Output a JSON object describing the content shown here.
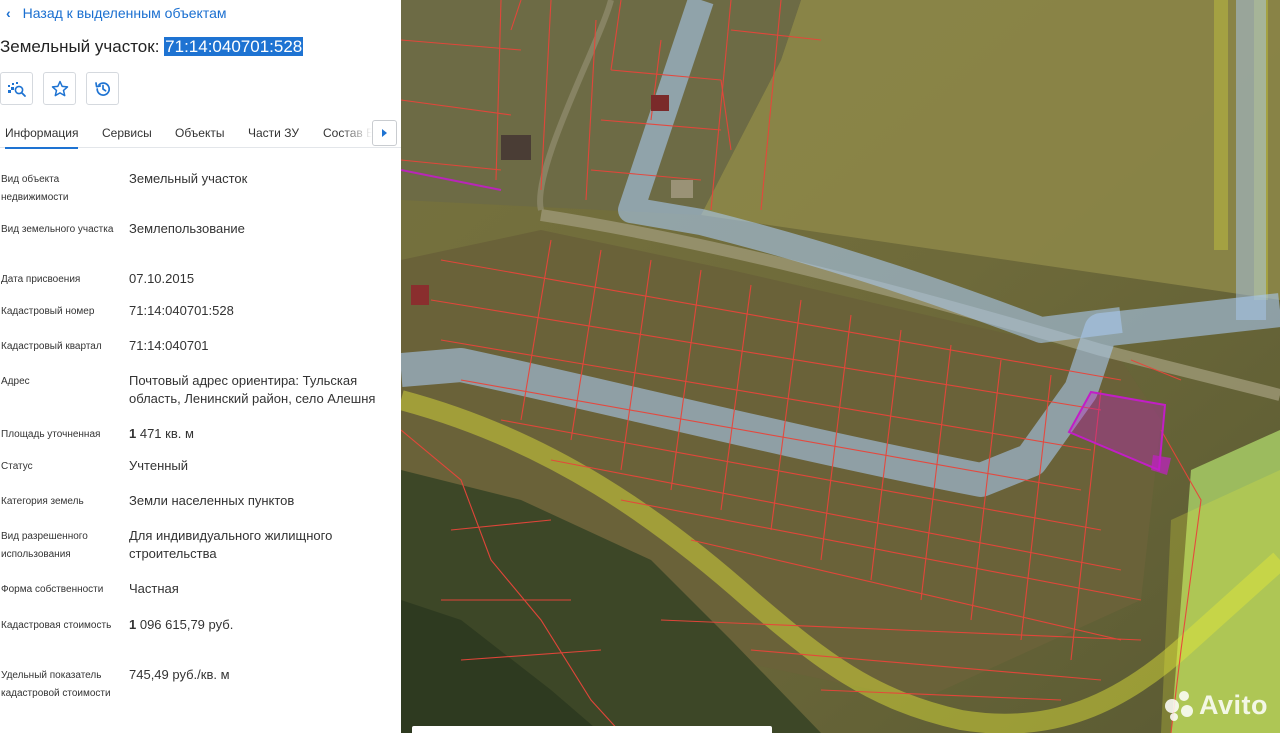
{
  "back_link": {
    "label": "Назад к выделенным объектам"
  },
  "title": {
    "prefix": "Земельный участок: ",
    "number": "71:14:040701:528"
  },
  "toolbar": {
    "buttons": [
      {
        "icon": "map-search-icon"
      },
      {
        "icon": "star-icon"
      },
      {
        "icon": "history-icon"
      }
    ]
  },
  "tabs": [
    {
      "label": "Информация",
      "active": true
    },
    {
      "label": "Сервисы"
    },
    {
      "label": "Объекты"
    },
    {
      "label": "Части ЗУ"
    },
    {
      "label": "Состав ЕЗП"
    }
  ],
  "properties": [
    {
      "label": "Вид объекта недвижимости",
      "value": "Земельный участок"
    },
    {
      "label": "Вид земельного участка",
      "value": "Землепользование"
    },
    {
      "label": "Дата присвоения",
      "value": "07.10.2015"
    },
    {
      "label": "Кадастровый номер",
      "value": "71:14:040701:528"
    },
    {
      "label": "Кадастровый квартал",
      "value": "71:14:040701"
    },
    {
      "label": "Адрес",
      "value": "Почтовый адрес ориентира: Тульская область, Ленинский район, село Алешня"
    },
    {
      "label": "Площадь уточненная",
      "value_bold": "1",
      "value": " 471 кв. м"
    },
    {
      "label": "Статус",
      "value": "Учтенный"
    },
    {
      "label": "Категория земель",
      "value": "Земли населенных пунктов"
    },
    {
      "label": "Вид разрешенного использования",
      "value": "Для индивидуального жилищного строительства"
    },
    {
      "label": "Форма собственности",
      "value": "Частная"
    },
    {
      "label": "Кадастровая стоимость",
      "value_bold": "1",
      "value": " 096 615,79 руб."
    },
    {
      "label": "Удельный показатель кадастровой стоимости",
      "value": "745,49 руб./кв. м"
    }
  ],
  "map": {
    "watermark": "Avito",
    "colors": {
      "parcel_border": "#e8453a",
      "zone_blue": "#a9c8ee",
      "zone_yellow": "#e4e83a",
      "selected_parcel": "#c21ec6"
    }
  }
}
